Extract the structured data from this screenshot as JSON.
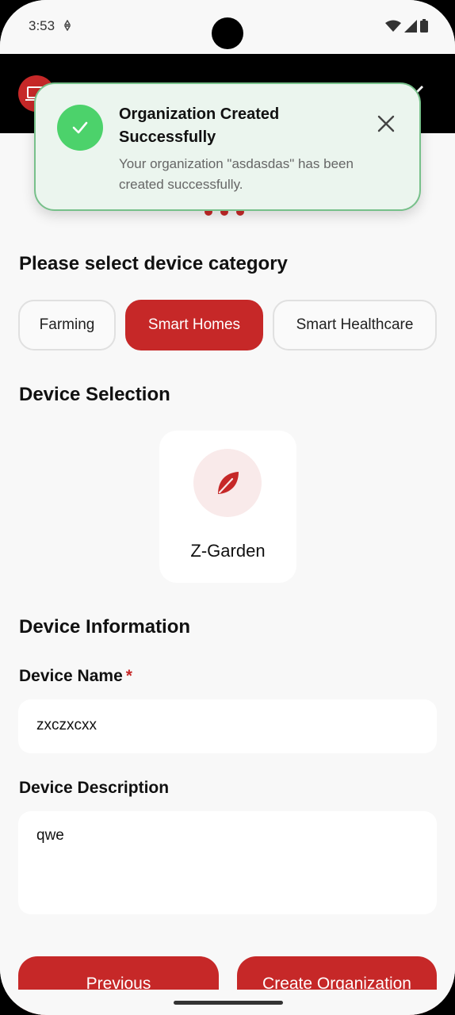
{
  "status_bar": {
    "time": "3:53"
  },
  "onboarding": {
    "category_title": "Please select device category",
    "categories": [
      {
        "label": "Farming",
        "selected": false
      },
      {
        "label": "Smart Homes",
        "selected": true
      },
      {
        "label": "Smart Healthcare",
        "selected": false
      }
    ],
    "device_selection_title": "Device Selection",
    "devices": [
      {
        "label": "Z-Garden",
        "icon": "leaf-icon"
      }
    ],
    "device_info_title": "Device Information",
    "device_name_label": "Device Name",
    "required_mark": "*",
    "device_name_value": "zxczxcxx",
    "device_description_label": "Device Description",
    "device_description_value": "qwe",
    "previous_button": "Previous",
    "create_button": "Create Organization"
  },
  "toast": {
    "title": "Organization Created Successfully",
    "message": "Your organization \"asdasdas\" has been created successfully."
  },
  "colors": {
    "accent": "#c62828",
    "success": "#4cd26b",
    "toast_bg": "#ebf5ee",
    "toast_border": "#77c08a"
  }
}
